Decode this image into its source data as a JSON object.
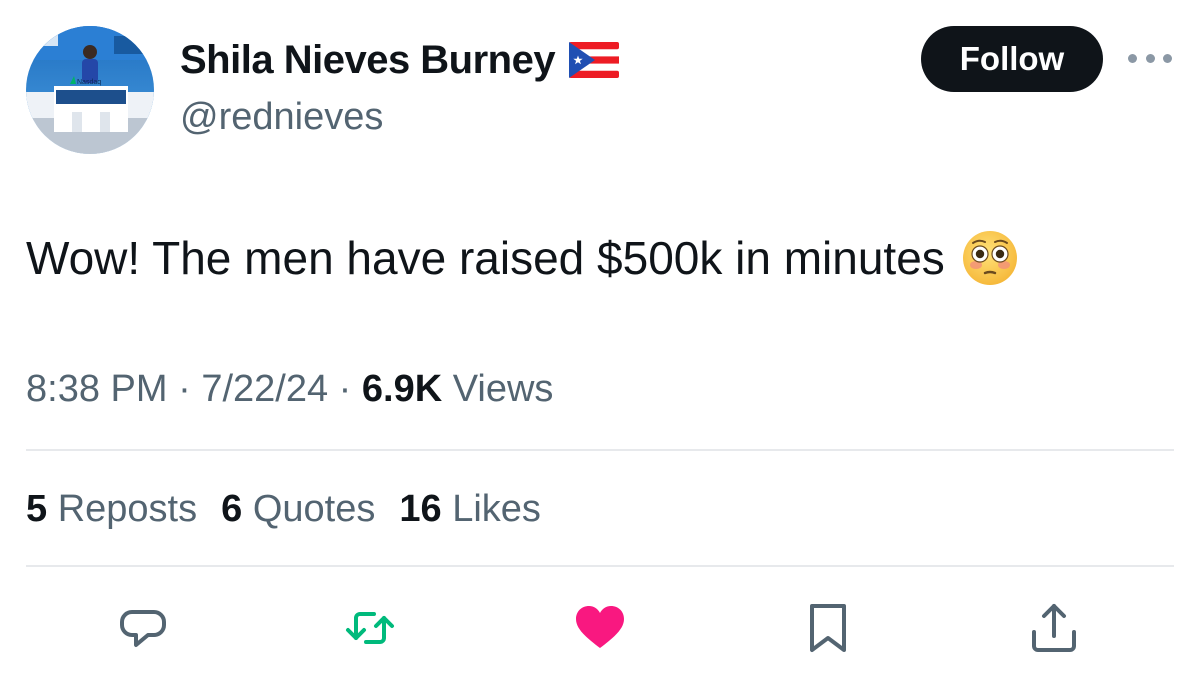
{
  "author": {
    "display_name": "Shila Nieves Burney",
    "handle": "@rednieves",
    "flag_icon": "puerto-rico-flag-icon",
    "avatar_logo_text": "Nasdaq"
  },
  "header": {
    "follow_label": "Follow",
    "more_icon": "more-horizontal-icon"
  },
  "tweet": {
    "text": "Wow! The men have raised $500k in minutes",
    "emoji": "flushed-face-emoji"
  },
  "meta": {
    "time": "8:38 PM",
    "separator": "·",
    "date": "7/22/24",
    "views_count": "6.9K",
    "views_label": "Views"
  },
  "stats": {
    "reposts_count": "5",
    "reposts_label": "Reposts",
    "quotes_count": "6",
    "quotes_label": "Quotes",
    "likes_count": "16",
    "likes_label": "Likes"
  },
  "actions": [
    {
      "name": "reply",
      "icon": "reply-icon",
      "color": "#536471"
    },
    {
      "name": "repost",
      "icon": "repost-icon",
      "color": "#00ba7c"
    },
    {
      "name": "like",
      "icon": "heart-icon",
      "color": "#f91880"
    },
    {
      "name": "bookmark",
      "icon": "bookmark-icon",
      "color": "#536471"
    },
    {
      "name": "share",
      "icon": "share-icon",
      "color": "#536471"
    }
  ],
  "colors": {
    "text_primary": "#0f1419",
    "text_secondary": "#536471",
    "follow_bg": "#0f1419",
    "divider": "#e7e9ec"
  }
}
